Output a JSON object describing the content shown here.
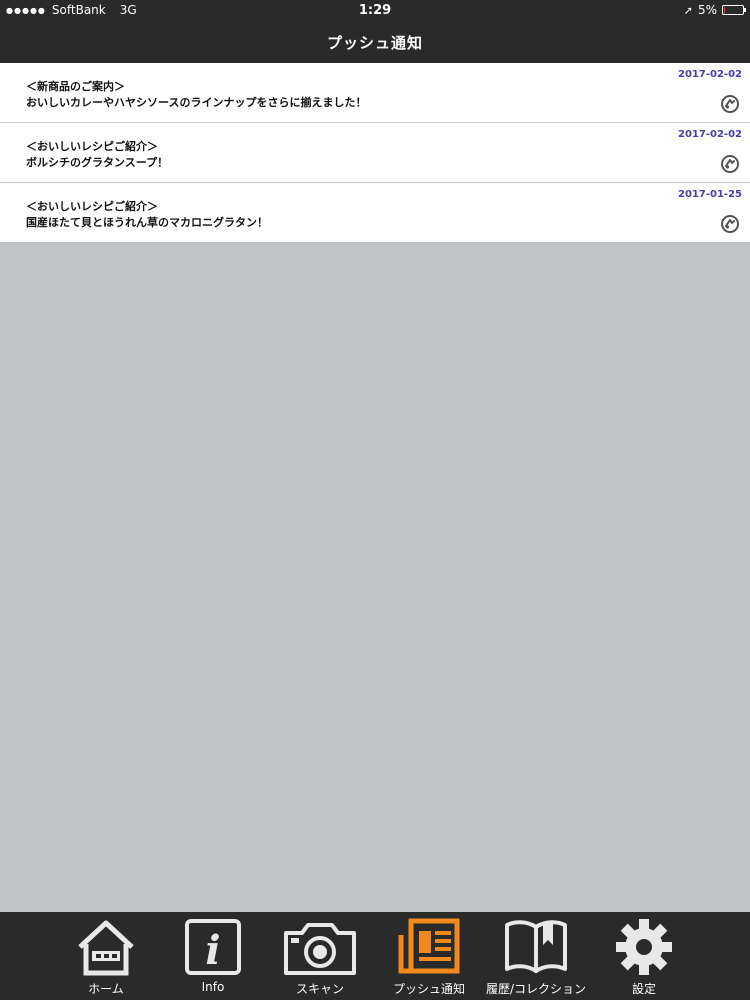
{
  "status_bar": {
    "signal_dots": "●●●●●",
    "carrier": "SoftBank",
    "network": "3G",
    "time": "1:29",
    "location_arrow": "➚",
    "battery_percent": "5%",
    "battery_level": 0.05
  },
  "header": {
    "title": "プッシュ通知"
  },
  "notifications": [
    {
      "category": "＜新商品のご案内＞",
      "text": "おいしいカレーやハヤシソースのラインナップをさらに揃えました！",
      "date": "2017-02-02",
      "icon": "link-icon"
    },
    {
      "category": "＜おいしいレシピご紹介＞",
      "text": "ボルシチのグラタンスープ！",
      "date": "2017-02-02",
      "icon": "link-icon"
    },
    {
      "category": "＜おいしいレシピご紹介＞",
      "text": "国産ほたて貝とほうれん草のマカロニグラタン！",
      "date": "2017-01-25",
      "icon": "link-icon"
    }
  ],
  "tabs": [
    {
      "label": "ホーム",
      "icon": "home-icon"
    },
    {
      "label": "Info",
      "icon": "info-icon"
    },
    {
      "label": "スキャン",
      "icon": "camera-icon"
    },
    {
      "label": "プッシュ通知",
      "icon": "newspaper-icon",
      "active": true
    },
    {
      "label": "履歴/コレクション",
      "icon": "book-icon"
    },
    {
      "label": "設定",
      "icon": "gear-icon"
    }
  ],
  "colors": {
    "header_bg": "#2a2a2a",
    "background": "#c0c4c6",
    "date_text": "#4840a8",
    "active_tab": "#f08a1c",
    "inactive_tab": "#e8e8e8"
  }
}
